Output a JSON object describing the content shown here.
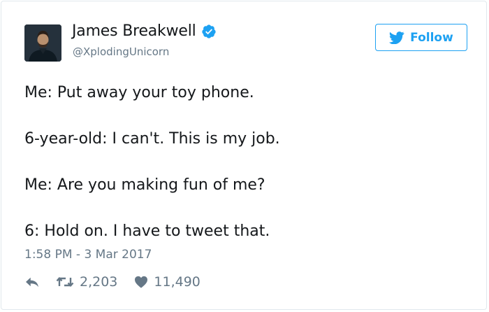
{
  "user": {
    "display_name": "James Breakwell",
    "handle": "@XplodingUnicorn",
    "verified": true
  },
  "follow_button": {
    "label": "Follow"
  },
  "tweet": {
    "lines": [
      "Me: Put away your toy phone.",
      "6-year-old: I can't. This is my job.",
      "Me: Are you making fun of me?",
      "6: Hold on. I have to tweet that."
    ],
    "timestamp": "1:58 PM - 3 Mar 2017"
  },
  "stats": {
    "retweets": "2,203",
    "likes": "11,490"
  },
  "icons": {
    "verified": "verified-badge-icon",
    "twitter": "twitter-bird-icon",
    "reply": "reply-icon",
    "retweet": "retweet-icon",
    "like": "heart-icon"
  },
  "colors": {
    "brand": "#1da1f2",
    "muted": "#657786",
    "text": "#14171a",
    "border": "#e1e8ed"
  }
}
